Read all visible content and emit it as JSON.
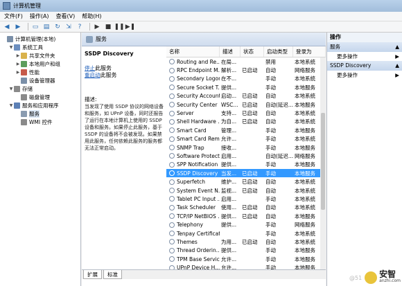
{
  "window": {
    "title": "计算机管理"
  },
  "menu": [
    "文件(F)",
    "操作(A)",
    "查看(V)",
    "帮助(H)"
  ],
  "toolbar": [
    "back-icon",
    "forward-icon",
    "folder-icon",
    "properties-icon",
    "refresh-icon",
    "export-icon",
    "help-icon",
    "play-icon",
    "stop-icon",
    "pause-icon",
    "restart-icon"
  ],
  "tree": [
    {
      "label": "计算机管理(本地)",
      "level": 0,
      "twisty": ""
    },
    {
      "label": "系统工具",
      "level": 1,
      "twisty": "▼"
    },
    {
      "label": "共享文件夹",
      "level": 2,
      "twisty": "▶"
    },
    {
      "label": "本地用户和组",
      "level": 2,
      "twisty": "▶"
    },
    {
      "label": "性能",
      "level": 2,
      "twisty": "▶"
    },
    {
      "label": "设备管理器",
      "level": 2,
      "twisty": ""
    },
    {
      "label": "存储",
      "level": 1,
      "twisty": "▼"
    },
    {
      "label": "磁盘管理",
      "level": 2,
      "twisty": ""
    },
    {
      "label": "服务和应用程序",
      "level": 1,
      "twisty": "▼"
    },
    {
      "label": "服务",
      "level": 2,
      "twisty": "",
      "selected": true
    },
    {
      "label": "WMI 控件",
      "level": 2,
      "twisty": ""
    }
  ],
  "panel": {
    "header": "服务",
    "service_name": "SSDP Discovery",
    "stop_link": "停止",
    "stop_suffix": "此服务",
    "restart_link": "重启动",
    "restart_suffix": "此服务",
    "desc_label": "描述:",
    "desc_text": "当发现了使用 SSDP 协议的网络设备和服务，如 UPnP 设备，同时还报告了运行在本地计算机上使用的 SSDP 设备和服务。如果停止此服务，基于 SSDP 的设备将不会被发现。如果禁用此服务，任何依赖此服务的服务都无法正常启动。"
  },
  "columns": [
    "名称",
    "描述",
    "状态",
    "启动类型",
    "登录为"
  ],
  "services": [
    {
      "name": "Routing and Re...",
      "desc": "在局...",
      "state": "",
      "start": "禁用",
      "logon": "本地系统"
    },
    {
      "name": "RPC Endpoint M...",
      "desc": "解析...",
      "state": "已启动",
      "start": "自动",
      "logon": "网络服务"
    },
    {
      "name": "Secondary Logon",
      "desc": "在不...",
      "state": "",
      "start": "手动",
      "logon": "本地系统"
    },
    {
      "name": "Secure Socket T...",
      "desc": "提供...",
      "state": "",
      "start": "手动",
      "logon": "本地服务"
    },
    {
      "name": "Security Account...",
      "desc": "启动...",
      "state": "已启动",
      "start": "自动",
      "logon": "本地系统"
    },
    {
      "name": "Security Center",
      "desc": "WSC...",
      "state": "已启动",
      "start": "自动(延迟...",
      "logon": "本地服务"
    },
    {
      "name": "Server",
      "desc": "支持...",
      "state": "已启动",
      "start": "自动",
      "logon": "本地系统"
    },
    {
      "name": "Shell Hardware ...",
      "desc": "为自...",
      "state": "已启动",
      "start": "自动",
      "logon": "本地系统"
    },
    {
      "name": "Smart Card",
      "desc": "管理...",
      "state": "",
      "start": "手动",
      "logon": "本地服务"
    },
    {
      "name": "Smart Card Rem...",
      "desc": "允许...",
      "state": "",
      "start": "手动",
      "logon": "本地系统"
    },
    {
      "name": "SNMP Trap",
      "desc": "接收...",
      "state": "",
      "start": "手动",
      "logon": "本地服务"
    },
    {
      "name": "Software Protect...",
      "desc": "启用...",
      "state": "",
      "start": "自动(延迟...",
      "logon": "网络服务"
    },
    {
      "name": "SPP Notification ...",
      "desc": "提供...",
      "state": "",
      "start": "手动",
      "logon": "本地服务"
    },
    {
      "name": "SSDP Discovery",
      "desc": "当发...",
      "state": "已启动",
      "start": "手动",
      "logon": "本地服务",
      "selected": true
    },
    {
      "name": "Superfetch",
      "desc": "维护...",
      "state": "已启动",
      "start": "自动",
      "logon": "本地系统"
    },
    {
      "name": "System Event N...",
      "desc": "监视...",
      "state": "已启动",
      "start": "自动",
      "logon": "本地系统"
    },
    {
      "name": "Tablet PC Input ...",
      "desc": "启用...",
      "state": "",
      "start": "手动",
      "logon": "本地系统"
    },
    {
      "name": "Task Scheduler",
      "desc": "使用...",
      "state": "已启动",
      "start": "自动",
      "logon": "本地系统"
    },
    {
      "name": "TCP/IP NetBIOS ...",
      "desc": "提供...",
      "state": "已启动",
      "start": "自动",
      "logon": "本地服务"
    },
    {
      "name": "Telephony",
      "desc": "提供...",
      "state": "",
      "start": "手动",
      "logon": "网络服务"
    },
    {
      "name": "Tenpay Certificat...",
      "desc": "",
      "state": "",
      "start": "手动",
      "logon": "本地系统"
    },
    {
      "name": "Themes",
      "desc": "为用...",
      "state": "已启动",
      "start": "自动",
      "logon": "本地系统"
    },
    {
      "name": "Thread Orderin...",
      "desc": "提供...",
      "state": "",
      "start": "手动",
      "logon": "本地服务"
    },
    {
      "name": "TPM Base Servic...",
      "desc": "允许...",
      "state": "",
      "start": "手动",
      "logon": "本地服务"
    },
    {
      "name": "UPnP Device H...",
      "desc": "允许...",
      "state": "",
      "start": "手动",
      "logon": "本地服务"
    }
  ],
  "tabs": [
    "扩展",
    "标准"
  ],
  "actions": {
    "title": "操作",
    "sections": [
      {
        "label": "服务",
        "items": [
          "更多操作"
        ]
      },
      {
        "label": "SSDP Discovery",
        "items": [
          "更多操作"
        ]
      }
    ]
  },
  "watermark": {
    "faint": "@51",
    "big": "安智",
    "small": "anzhi.com"
  }
}
